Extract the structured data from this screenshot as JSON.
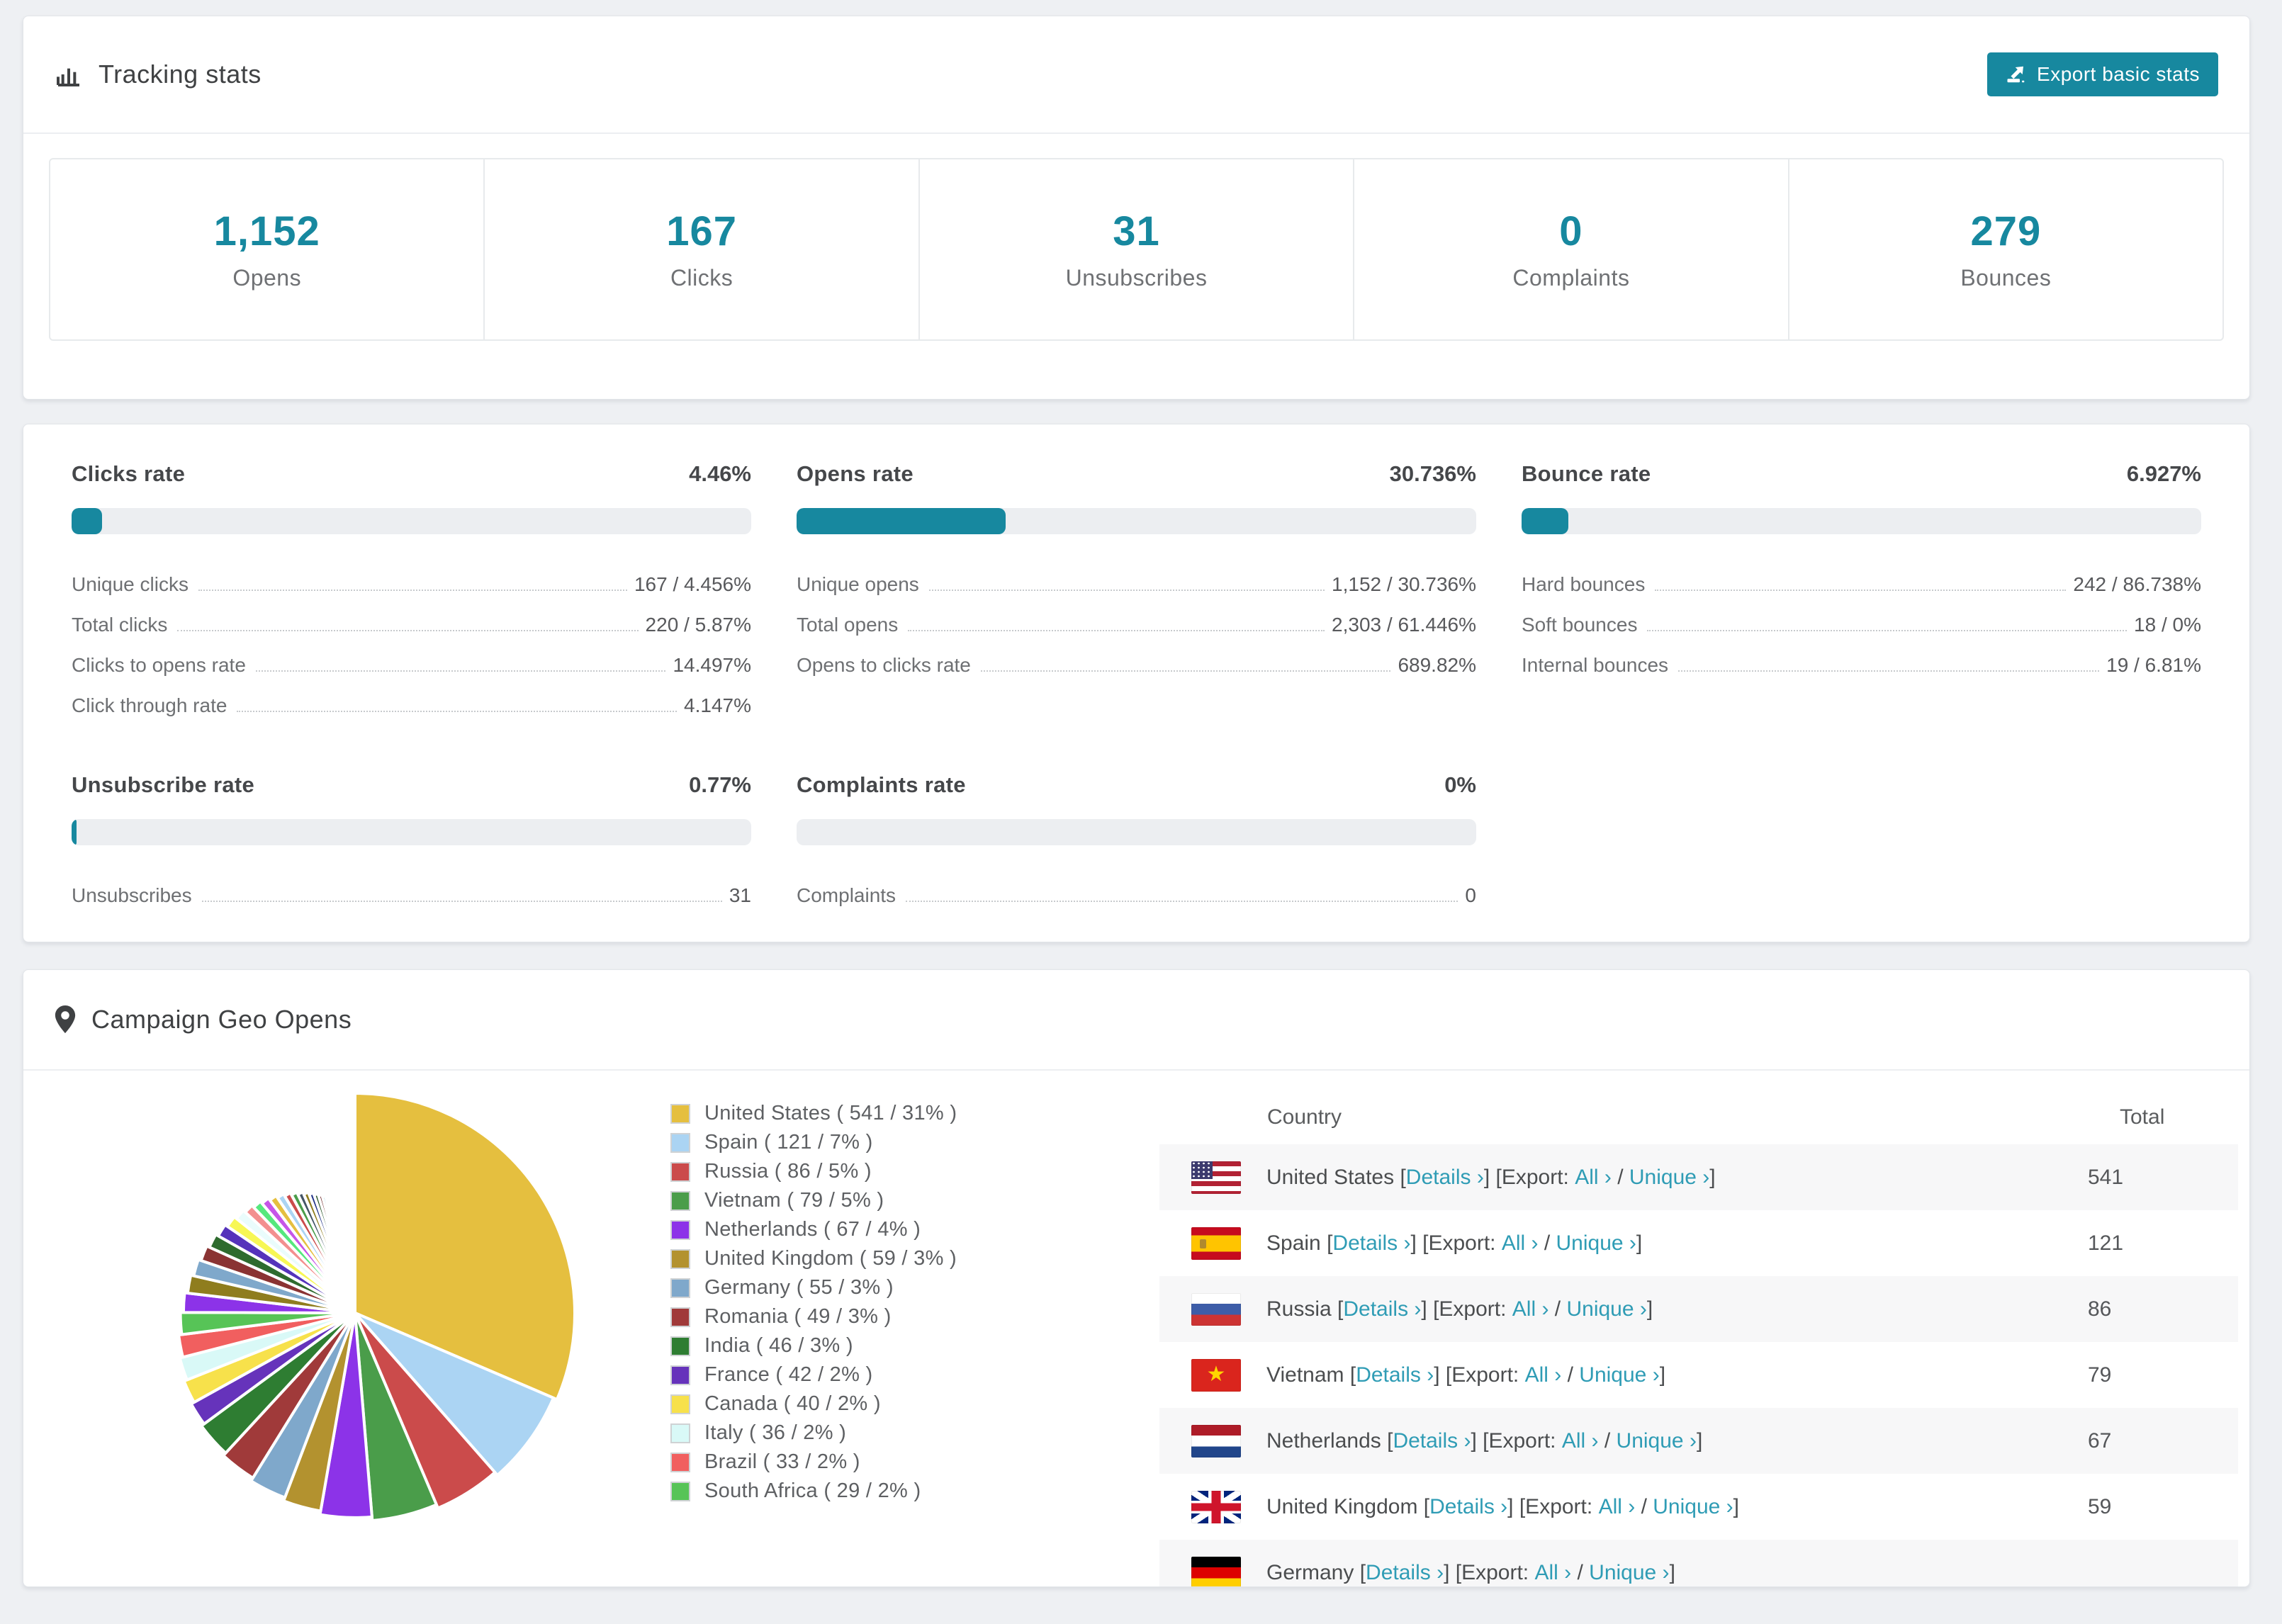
{
  "colors": {
    "accent": "#17889f",
    "link": "#2f9cb5",
    "page_bg": "#eef0f3"
  },
  "tracking": {
    "title": "Tracking stats",
    "export_button": "Export basic stats",
    "summary": [
      {
        "value": "1,152",
        "label": "Opens"
      },
      {
        "value": "167",
        "label": "Clicks"
      },
      {
        "value": "31",
        "label": "Unsubscribes"
      },
      {
        "value": "0",
        "label": "Complaints"
      },
      {
        "value": "279",
        "label": "Bounces"
      }
    ]
  },
  "rates": {
    "top_blocks": [
      {
        "title": "Clicks rate",
        "value": "4.46%",
        "pct": 4.46,
        "rows": [
          {
            "label": "Unique clicks",
            "value": "167 / 4.456%"
          },
          {
            "label": "Total clicks",
            "value": "220 / 5.87%"
          },
          {
            "label": "Clicks to opens rate",
            "value": "14.497%"
          },
          {
            "label": "Click through rate",
            "value": "4.147%"
          }
        ]
      },
      {
        "title": "Opens rate",
        "value": "30.736%",
        "pct": 30.736,
        "rows": [
          {
            "label": "Unique opens",
            "value": "1,152 / 30.736%"
          },
          {
            "label": "Total opens",
            "value": "2,303 / 61.446%"
          },
          {
            "label": "Opens to clicks rate",
            "value": "689.82%"
          }
        ]
      },
      {
        "title": "Bounce rate",
        "value": "6.927%",
        "pct": 6.927,
        "rows": [
          {
            "label": "Hard bounces",
            "value": "242 / 86.738%"
          },
          {
            "label": "Soft bounces",
            "value": "18 / 0%"
          },
          {
            "label": "Internal bounces",
            "value": "19 / 6.81%"
          }
        ]
      }
    ],
    "bottom_blocks": [
      {
        "title": "Unsubscribe rate",
        "value": "0.77%",
        "pct": 0.77,
        "rows": [
          {
            "label": "Unsubscribes",
            "value": "31"
          }
        ]
      },
      {
        "title": "Complaints rate",
        "value": "0%",
        "pct": 0,
        "rows": [
          {
            "label": "Complaints",
            "value": "0"
          }
        ]
      }
    ]
  },
  "geo": {
    "title": "Campaign Geo Opens",
    "chart_data": {
      "type": "pie",
      "title": "Campaign Geo Opens",
      "unit": "opens",
      "start_angle": -90,
      "direction": "clockwise",
      "legend_position": "right",
      "labels": [
        "United States",
        "Spain",
        "Russia",
        "Vietnam",
        "Netherlands",
        "United Kingdom",
        "Germany",
        "Romania",
        "India",
        "France",
        "Canada",
        "Italy",
        "Brazil",
        "South Africa"
      ],
      "values": [
        541,
        121,
        86,
        79,
        67,
        59,
        55,
        49,
        46,
        42,
        40,
        36,
        33,
        29
      ],
      "percents": [
        31,
        7,
        5,
        5,
        4,
        3,
        3,
        3,
        3,
        2,
        2,
        2,
        2,
        2
      ],
      "colors": [
        "#e5bf3f",
        "#abd4f3",
        "#cb4b4b",
        "#4a9d4a",
        "#8c33e8",
        "#b3922f",
        "#7fa8cb",
        "#a03a3a",
        "#2e7d32",
        "#6633bb",
        "#f7e14b",
        "#d9f9f7",
        "#f15f5f",
        "#57c457"
      ],
      "others_tail": {
        "note": "remaining unlabeled small-country slices (~26% combined), drawn as progressively thinner slivers",
        "values": [
          1.8,
          1.7,
          1.6,
          1.5,
          1.4,
          1.3,
          1.2,
          1.1,
          1.0,
          0.95,
          0.9,
          0.85,
          0.8,
          0.75,
          0.7,
          0.65,
          0.6,
          0.55,
          0.5,
          0.45,
          0.4,
          0.38,
          0.36,
          0.34,
          0.32,
          0.3,
          0.28,
          0.26,
          0.24,
          0.22,
          0.2,
          0.18,
          0.16,
          0.14,
          0.12,
          0.1,
          0.09,
          0.08,
          0.07,
          0.06
        ],
        "colors": [
          "#8c33e8",
          "#8f7d1e",
          "#7fa8cb",
          "#8a3333",
          "#2e6b2e",
          "#5533bb",
          "#f7f755",
          "#eafcfc",
          "#f38f8f",
          "#55e87d",
          "#c655e8",
          "#e5bf3f",
          "#abd4f3",
          "#cb4b4b",
          "#4a9d4a",
          "#445566",
          "#8f7d1e",
          "#223388",
          "#1e4d1e",
          "#6b2222",
          "#2f9cb5",
          "#e84f9b",
          "#7de87d",
          "#f15f5f",
          "#f7e14b",
          "#cfe8fa",
          "#ffff55",
          "#2e2e8f",
          "#2e5c2e",
          "#a04444",
          "#b455e8",
          "#57c457",
          "#6633bb",
          "#f15f5f",
          "#7fa8cb",
          "#e5bf3f",
          "#abd4f3",
          "#cb4b4b",
          "#4a9d4a",
          "#8c33e8"
        ]
      }
    },
    "legend": [
      {
        "label": "United States ( 541 / 31% )",
        "color": "#e5bf3f"
      },
      {
        "label": "Spain ( 121 / 7% )",
        "color": "#abd4f3"
      },
      {
        "label": "Russia ( 86 / 5% )",
        "color": "#cb4b4b"
      },
      {
        "label": "Vietnam ( 79 / 5% )",
        "color": "#4a9d4a"
      },
      {
        "label": "Netherlands ( 67 / 4% )",
        "color": "#8c33e8"
      },
      {
        "label": "United Kingdom ( 59 / 3% )",
        "color": "#b3922f"
      },
      {
        "label": "Germany ( 55 / 3% )",
        "color": "#7fa8cb"
      },
      {
        "label": "Romania ( 49 / 3% )",
        "color": "#a03a3a"
      },
      {
        "label": "India ( 46 / 3% )",
        "color": "#2e7d32"
      },
      {
        "label": "France ( 42 / 2% )",
        "color": "#6633bb"
      },
      {
        "label": "Canada ( 40 / 2% )",
        "color": "#f7e14b"
      },
      {
        "label": "Italy ( 36 / 2% )",
        "color": "#d9f9f7"
      },
      {
        "label": "Brazil ( 33 / 2% )",
        "color": "#f15f5f"
      },
      {
        "label": "South Africa ( 29 / 2% )",
        "color": "#57c457"
      }
    ],
    "table": {
      "columns": [
        "Country",
        "Total"
      ],
      "labels": {
        "details": "Details ›",
        "export_prefix": "[Export:",
        "all": "All ›",
        "unique": "Unique ›"
      },
      "rows": [
        {
          "country": "United States",
          "flag": "us",
          "total": "541"
        },
        {
          "country": "Spain",
          "flag": "es",
          "total": "121"
        },
        {
          "country": "Russia",
          "flag": "ru",
          "total": "86"
        },
        {
          "country": "Vietnam",
          "flag": "vn",
          "total": "79"
        },
        {
          "country": "Netherlands",
          "flag": "nl",
          "total": "67"
        },
        {
          "country": "United Kingdom",
          "flag": "gb",
          "total": "59"
        },
        {
          "country": "Germany",
          "flag": "de",
          "total": ""
        }
      ]
    }
  }
}
